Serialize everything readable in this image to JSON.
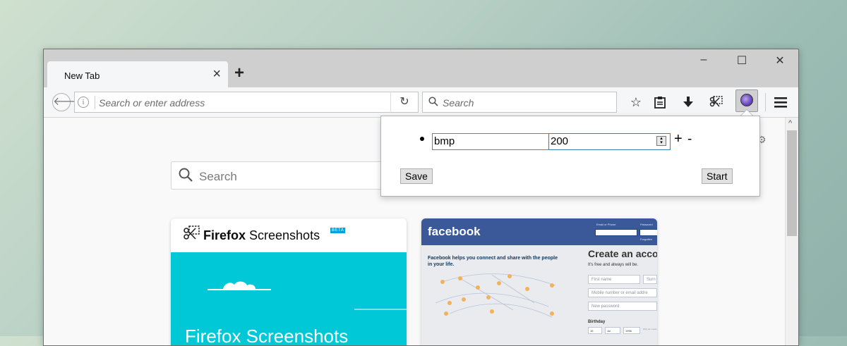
{
  "browser": {
    "tab": {
      "title": "New Tab",
      "close_glyph": "×"
    },
    "new_tab_glyph": "+",
    "window_controls": {
      "minimize": "–",
      "maximize": "☐",
      "close": "✕"
    }
  },
  "toolbar": {
    "address_placeholder": "Search or enter address",
    "search_placeholder": "Search",
    "icons": [
      "back-icon",
      "info-icon",
      "reload-icon",
      "search-icon",
      "bookmark-star-icon",
      "reader-clipboard-icon",
      "downloads-icon",
      "screenshots-icon",
      "extension-icon",
      "menu-icon"
    ]
  },
  "newtab": {
    "search_placeholder": "Search",
    "tiles": [
      {
        "id": "screenshots",
        "brand_bold": "Firefox",
        "brand_regular": " Screenshots",
        "badge": "BETA",
        "body_text": "Firefox Screenshots",
        "colors": {
          "body": "#00c8d7"
        }
      },
      {
        "id": "facebook",
        "logo": "facebook",
        "email_label": "Email or Phone",
        "password_label": "Password",
        "forgot_label": "Forgotten",
        "tagline": "Facebook helps you connect and share with the people in your life.",
        "headline": "Create an acco",
        "subline": "It's free and always will be.",
        "fields": [
          "First name",
          "Surn",
          "Mobile number or email addre",
          "New password"
        ],
        "birthday_label": "Birthday",
        "birthday_values": [
          "15",
          "Jul",
          "1996"
        ],
        "birthday_note": "Why do I need to provide my date of",
        "colors": {
          "header": "#3b5998"
        }
      }
    ]
  },
  "popup": {
    "type_value": "bmp",
    "number_value": "200",
    "plus_label": "+",
    "minus_label": "-",
    "save_label": "Save",
    "start_label": "Start"
  }
}
